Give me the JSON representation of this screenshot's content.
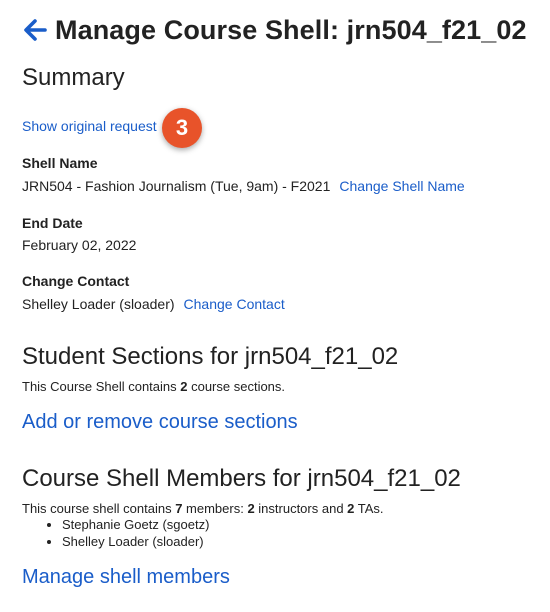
{
  "header": {
    "title": "Manage Course Shell: jrn504_f21_02",
    "back_icon": "back-arrow-icon"
  },
  "summary": {
    "title": "Summary",
    "show_original_label": "Show original request",
    "step_badge": "3"
  },
  "shell_name": {
    "label": "Shell Name",
    "value": "JRN504 - Fashion Journalism (Tue, 9am) - F2021",
    "change_label": "Change Shell Name"
  },
  "end_date": {
    "label": "End Date",
    "value": "February 02, 2022"
  },
  "change_contact": {
    "label": "Change Contact",
    "value": "Shelley Loader (sloader)",
    "change_label": "Change Contact"
  },
  "student_sections": {
    "title": "Student Sections for jrn504_f21_02",
    "text_before": "This Course Shell contains ",
    "count": "2",
    "text_after": " course sections.",
    "link_label": "Add or remove course sections"
  },
  "members": {
    "title": "Course Shell Members for jrn504_f21_02",
    "text_before": "This course shell contains ",
    "member_count": "7",
    "text_middle": " members: ",
    "instructor_count": "2",
    "text_instructors": " instructors and ",
    "ta_count": "2",
    "text_tas": " TAs.",
    "list": [
      "Stephanie Goetz (sgoetz)",
      "Shelley Loader (sloader)"
    ],
    "link_label": "Manage shell members"
  },
  "colors": {
    "link": "#1a5dc9",
    "badge": "#e8532a",
    "text": "#222222"
  }
}
